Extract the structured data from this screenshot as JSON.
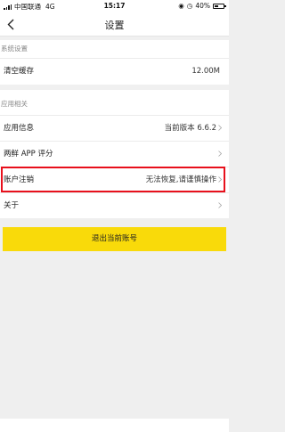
{
  "status_bar": {
    "carrier": "中国联通",
    "network": "4G",
    "time": "15:17",
    "battery": "40%"
  },
  "header": {
    "title": "设置",
    "back_icon": "chevron-left-icon"
  },
  "sections": {
    "system": {
      "label": "系统设置",
      "items": [
        {
          "label": "清空缓存",
          "value": "12.00M"
        }
      ]
    },
    "app": {
      "label": "应用相关",
      "items": [
        {
          "label": "应用信息",
          "value": "当前版本 6.6.2"
        },
        {
          "label": "两鲜 APP 评分",
          "value": ""
        },
        {
          "label": "账户注销",
          "value": "无法恢复,请谨慎操作"
        },
        {
          "label": "关于",
          "value": ""
        }
      ]
    }
  },
  "logout_button": "退出当前账号",
  "colors": {
    "accent_yellow": "#f9da0a",
    "highlight_red": "#e8101c",
    "background": "#efefef"
  }
}
